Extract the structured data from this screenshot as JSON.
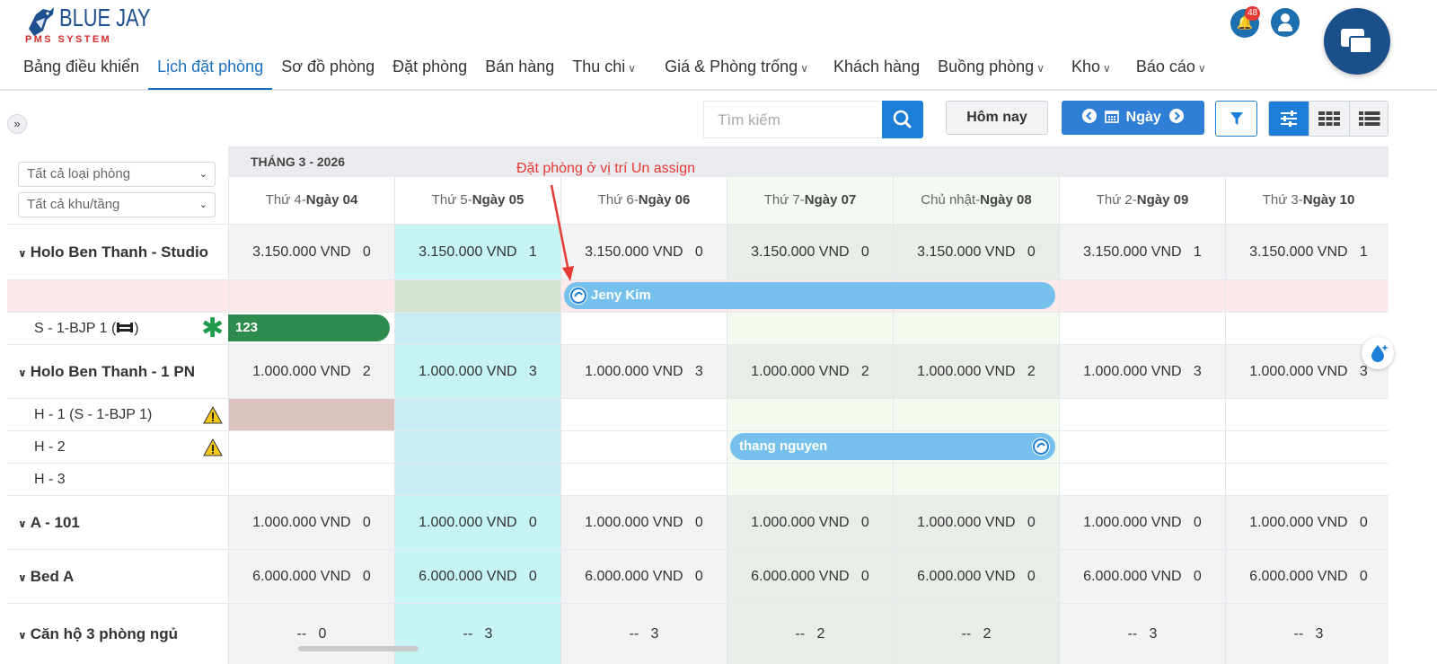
{
  "app": {
    "brand": "BLUE JAY",
    "brand_sub": "PMS SYSTEM",
    "notifications_count": "48"
  },
  "nav": {
    "items": [
      {
        "label": "Bảng điều khiển",
        "active": false,
        "dropdown": false
      },
      {
        "label": "Lịch đặt phòng",
        "active": true,
        "dropdown": false
      },
      {
        "label": "Sơ đồ phòng",
        "active": false,
        "dropdown": false
      },
      {
        "label": "Đặt phòng",
        "active": false,
        "dropdown": false
      },
      {
        "label": "Bán hàng",
        "active": false,
        "dropdown": false
      },
      {
        "label": "Thu chi",
        "active": false,
        "dropdown": true
      },
      {
        "label": "Giá & Phòng trống",
        "active": false,
        "dropdown": true
      },
      {
        "label": "Khách hàng",
        "active": false,
        "dropdown": false
      },
      {
        "label": "Buồng phòng",
        "active": false,
        "dropdown": true
      },
      {
        "label": "Kho",
        "active": false,
        "dropdown": true
      },
      {
        "label": "Báo cáo",
        "active": false,
        "dropdown": true
      }
    ]
  },
  "toolbar": {
    "expand_glyph": "»",
    "search_placeholder": "Tìm kiếm",
    "today_label": "Hôm nay",
    "day_label": "Ngày"
  },
  "filters": {
    "room_type": "Tất cả loại phòng",
    "area_floor": "Tất cả khu/tầng"
  },
  "calendar": {
    "month_label": "THÁNG 3 - 2026",
    "days": [
      {
        "weekday": "Thứ 4-",
        "day": "Ngày 04"
      },
      {
        "weekday": "Thứ 5-",
        "day": "Ngày 05"
      },
      {
        "weekday": "Thứ 6-",
        "day": "Ngày 06"
      },
      {
        "weekday": "Thứ 7-",
        "day": "Ngày 07"
      },
      {
        "weekday": "Chủ nhật-",
        "day": "Ngày 08"
      },
      {
        "weekday": "Thứ 2-",
        "day": "Ngày 09"
      },
      {
        "weekday": "Thứ 3-",
        "day": "Ngày 10"
      }
    ],
    "rows": [
      {
        "label": "Holo Ben Thanh - Studio",
        "group": true,
        "cells": [
          "3.150.000 VND   0",
          "3.150.000 VND   1",
          "3.150.000 VND   0",
          "3.150.000 VND   0",
          "3.150.000 VND   0",
          "3.150.000 VND   1",
          "3.150.000 VND   1"
        ]
      },
      {
        "label": "",
        "group": false,
        "unassigned": true
      },
      {
        "label": "S - 1-BJP 1 (",
        "label_suffix": ")",
        "group": false
      },
      {
        "label": "Holo Ben Thanh - 1 PN",
        "group": true,
        "cells": [
          "1.000.000 VND   2",
          "1.000.000 VND   3",
          "1.000.000 VND   3",
          "1.000.000 VND   2",
          "1.000.000 VND   2",
          "1.000.000 VND   3",
          "1.000.000 VND   3"
        ]
      },
      {
        "label": "H - 1 (S - 1-BJP 1)",
        "group": false
      },
      {
        "label": "H - 2",
        "group": false
      },
      {
        "label": "H - 3",
        "group": false
      },
      {
        "label": "A - 101",
        "group": true,
        "cells": [
          "1.000.000 VND   0",
          "1.000.000 VND   0",
          "1.000.000 VND   0",
          "1.000.000 VND   0",
          "1.000.000 VND   0",
          "1.000.000 VND   0",
          "1.000.000 VND   0"
        ]
      },
      {
        "label": "Bed A",
        "group": true,
        "cells": [
          "6.000.000 VND   0",
          "6.000.000 VND   0",
          "6.000.000 VND   0",
          "6.000.000 VND   0",
          "6.000.000 VND   0",
          "6.000.000 VND   0",
          "6.000.000 VND   0"
        ]
      },
      {
        "label": "Căn hộ 3 phòng ngủ",
        "group": true,
        "cells": [
          "--   0",
          "--   3",
          "--   3",
          "--   2",
          "--   2",
          "--   3",
          "--   3"
        ]
      }
    ]
  },
  "bookings": {
    "jeny": "Jeny Kim",
    "s1": "123",
    "thang": "thang nguyen"
  },
  "annotation": "Đặt phòng ở vị trí Un assign",
  "colors": {
    "primary": "#1c7ed6",
    "booking_blue": "#75c0ec",
    "booking_green": "#2e8b4e",
    "today_col": "#c5f3f3",
    "weekend_col": "#eef7ea",
    "unassigned_row": "#fde9ea",
    "annotation": "#e53935"
  }
}
